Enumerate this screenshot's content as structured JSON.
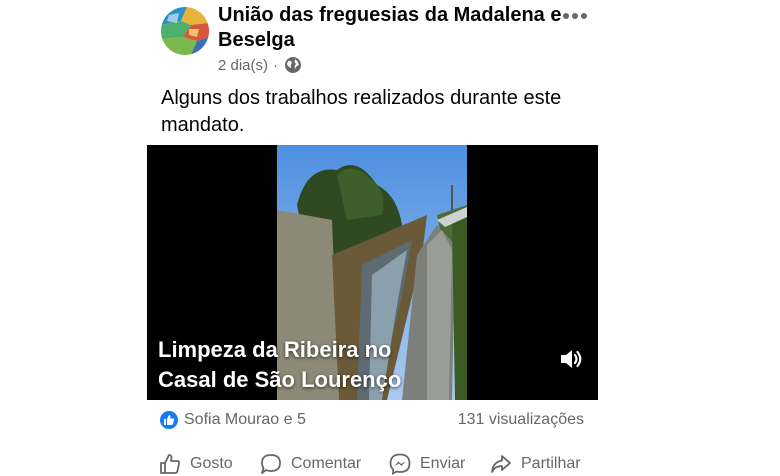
{
  "post": {
    "page_name": "União das freguesias  da Madalena e Beselga",
    "time": "2 dia(s)",
    "separator": "·",
    "caption": "Alguns dos trabalhos realizados durante este mandato.",
    "video": {
      "title_line1": "Limpeza da Ribeira no",
      "title_line2": "Casal de São Lourenço"
    },
    "reactions_text": "Sofia Mourao e 5",
    "views_text": "131 visualizações",
    "actions": {
      "like": "Gosto",
      "comment": "Comentar",
      "send": "Enviar",
      "share": "Partilhar"
    }
  },
  "colors": {
    "like_blue": "#1877f2",
    "secondary_text": "#65676b"
  },
  "icons": [
    "globe-icon",
    "more-options-icon",
    "volume-icon",
    "like-reaction-icon",
    "like-icon",
    "comment-icon",
    "messenger-icon",
    "share-icon"
  ]
}
